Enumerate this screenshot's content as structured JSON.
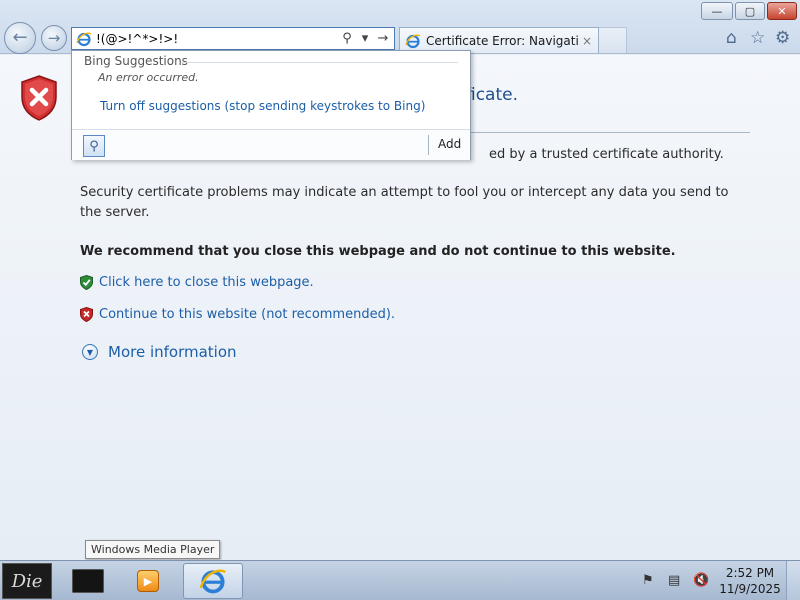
{
  "browser": {
    "address_value": "!(@>!^*>!>!",
    "tab_title": "Certificate Error: Navigatio...",
    "tab_close": "×",
    "window_controls": {
      "minimize": "—",
      "maximize": "▢",
      "close": "✕"
    },
    "toolbar_icons": [
      "home-icon",
      "star-icon",
      "gear-icon"
    ]
  },
  "page": {
    "heading_partial": "ficate.",
    "para1_partial": "ed by a trusted certificate authority.",
    "para2": "Security certificate problems may indicate an attempt to fool you or intercept any data you send to the server.",
    "recommend": "We recommend that you close this webpage and do not continue to this website.",
    "close_link": "Click here to close this webpage.",
    "continue_link": "Continue to this website (not recommended).",
    "more_info": "More information"
  },
  "suggestions": {
    "header": "Bing Suggestions",
    "error": "An error occurred.",
    "turn_off": "Turn off suggestions (stop sending keystrokes to Bing)",
    "add": "Add"
  },
  "tooltip": "Windows Media Player",
  "taskbar": {
    "start_label": "Die",
    "time": "2:52 PM",
    "date": "11/9/2025"
  },
  "colors": {
    "link": "#1c5ea7",
    "heading": "#1f4e8c",
    "error_red": "#c62828",
    "safe_green": "#2e8b3a"
  }
}
